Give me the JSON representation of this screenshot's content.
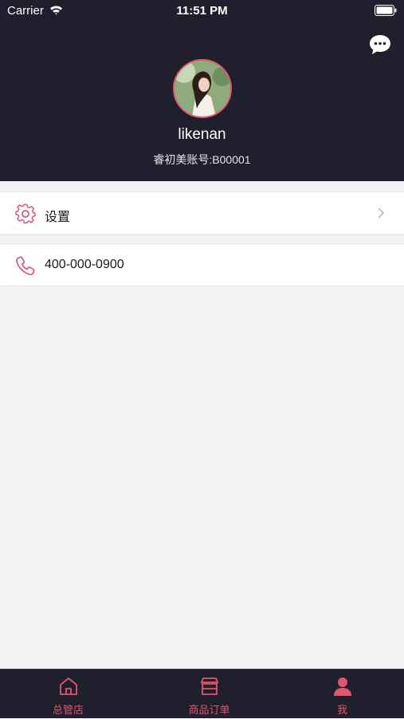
{
  "status_bar": {
    "carrier": "Carrier",
    "time": "11:51 PM"
  },
  "colors": {
    "header_bg": "#1f1f2d",
    "accent": "#e2566d",
    "page_bg": "#f2f2f2"
  },
  "profile": {
    "username": "likenan",
    "account_line": "睿初美账号:B00001"
  },
  "menu": {
    "settings": {
      "label": "设置",
      "icon": "gear-icon"
    },
    "phone": {
      "label": "400-000-0900",
      "icon": "phone-icon"
    }
  },
  "tabbar": {
    "items": [
      {
        "label": "总管店",
        "icon": "home-icon"
      },
      {
        "label": "商品订单",
        "icon": "store-icon"
      },
      {
        "label": "我",
        "icon": "person-icon",
        "selected": true
      }
    ]
  }
}
